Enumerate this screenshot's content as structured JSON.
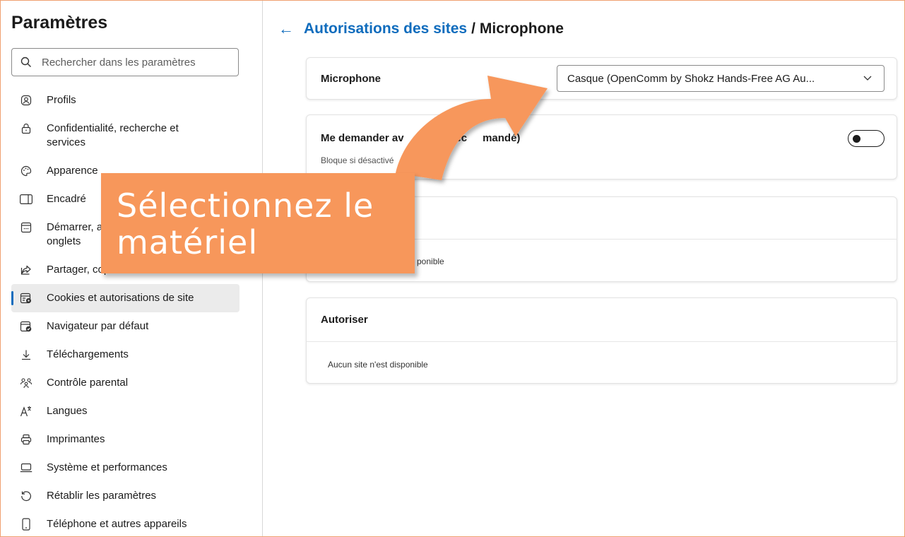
{
  "sidebar": {
    "title": "Paramètres",
    "search_placeholder": "Rechercher dans les paramètres",
    "items": [
      {
        "label": "Profils",
        "icon": "profile-icon"
      },
      {
        "label": "Confidentialité, recherche et\nservices",
        "icon": "lock-icon"
      },
      {
        "label": "Apparence",
        "icon": "palette-icon"
      },
      {
        "label": "Encadré",
        "icon": "sidebar-panel-icon"
      },
      {
        "label": "Démarrer, accueil et nouveaux\nonglets",
        "icon": "start-page-icon"
      },
      {
        "label": "Partager, copier et coller",
        "icon": "share-icon"
      },
      {
        "label": "Cookies et autorisations de site",
        "icon": "cookies-permissions-icon",
        "active": true
      },
      {
        "label": "Navigateur par défaut",
        "icon": "default-browser-icon"
      },
      {
        "label": "Téléchargements",
        "icon": "download-icon"
      },
      {
        "label": "Contrôle parental",
        "icon": "family-icon"
      },
      {
        "label": "Langues",
        "icon": "language-icon"
      },
      {
        "label": "Imprimantes",
        "icon": "printer-icon"
      },
      {
        "label": "Système et performances",
        "icon": "laptop-icon"
      },
      {
        "label": "Rétablir les paramètres",
        "icon": "reset-icon"
      },
      {
        "label": "Téléphone et autres appareils",
        "icon": "phone-icon"
      }
    ]
  },
  "header": {
    "breadcrumb_link": "Autorisations des sites",
    "separator": "/",
    "current": "Microphone"
  },
  "microphone_card": {
    "label": "Microphone",
    "selected_device": "Casque (OpenComm by Shokz Hands-Free AG Au..."
  },
  "ask_card": {
    "label_visible_a": "Me demander av",
    "label_visible_b": "(rec",
    "label_visible_c": "mandé)",
    "subtext": "Bloque si désactivé",
    "toggle_on": true
  },
  "block_card": {
    "empty_text_visible": "ponible"
  },
  "allow_card": {
    "title": "Autoriser",
    "empty_text": "Aucun site n'est disponible"
  },
  "callout": {
    "text": "Sélectionnez le matériel",
    "color": "#f7975b"
  }
}
